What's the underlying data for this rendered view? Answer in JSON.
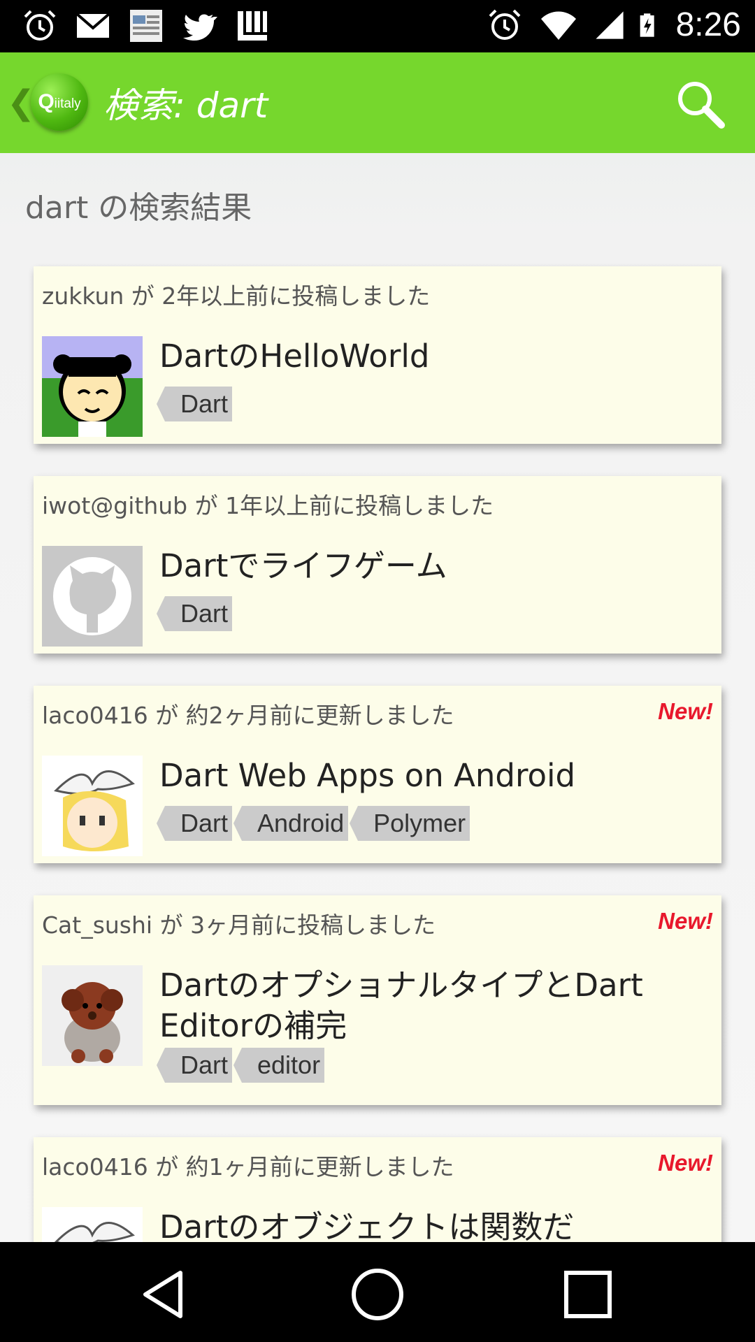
{
  "status_bar": {
    "icons_left": [
      "alarm-icon",
      "gmail-icon",
      "smartnews-icon",
      "twitter-icon",
      "launcher-icon"
    ],
    "icons_right": [
      "alarm-icon",
      "wifi-icon",
      "signal-icon",
      "battery-charging-icon"
    ],
    "time": "8:26"
  },
  "app_bar": {
    "logo": {
      "q": "Q",
      "rest": "iitaly"
    },
    "title": "検索: dart",
    "background_color": "#76d72d"
  },
  "results_heading": "dart の検索結果",
  "items": [
    {
      "meta": "zukkun が 2年以上前に投稿しました",
      "title": "DartのHelloWorld",
      "tags": [
        "Dart"
      ],
      "new_label": "",
      "avatar": "pixel-bear-avatar"
    },
    {
      "meta": "iwot@github が 1年以上前に投稿しました",
      "title": "Dartでライフゲーム",
      "tags": [
        "Dart"
      ],
      "new_label": "",
      "avatar": "github-octocat-avatar"
    },
    {
      "meta": "laco0416 が 約2ヶ月前に更新しました",
      "title": "Dart Web Apps on Android",
      "tags": [
        "Dart",
        "Android",
        "Polymer"
      ],
      "new_label": "New!",
      "avatar": "anime-girl-avatar"
    },
    {
      "meta": "Cat_sushi が 3ヶ月前に投稿しました",
      "title": "DartのオプショナルタイプとDart Editorの補完",
      "tags": [
        "Dart",
        "editor"
      ],
      "new_label": "New!",
      "avatar": "brown-dog-avatar"
    },
    {
      "meta": "laco0416 が 約1ヶ月前に更新しました",
      "title": "Dartのオブジェクトは関数だ",
      "tags": [],
      "new_label": "New!",
      "avatar": "anime-girl-avatar"
    }
  ],
  "nav_bar": {
    "buttons": [
      "back-icon",
      "home-icon",
      "recents-icon"
    ]
  }
}
